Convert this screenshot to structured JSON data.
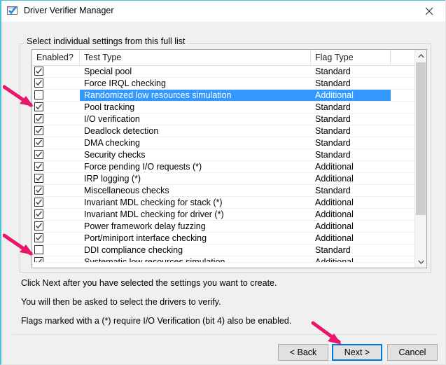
{
  "window": {
    "title": "Driver Verifier Manager",
    "icon": "driver-verifier-icon",
    "close_label": "✕",
    "accent_color": "#4cc2d6"
  },
  "groupbox": {
    "label": "Select individual settings from this full list"
  },
  "listview": {
    "columns": [
      "Enabled?",
      "Test Type",
      "Flag Type",
      ""
    ],
    "selection_color": "#3399ff",
    "rows": [
      {
        "enabled": true,
        "test": "Special pool",
        "flag": "Standard",
        "selected": false
      },
      {
        "enabled": true,
        "test": "Force IRQL checking",
        "flag": "Standard",
        "selected": false
      },
      {
        "enabled": false,
        "test": "Randomized low resources simulation",
        "flag": "Additional",
        "selected": true
      },
      {
        "enabled": true,
        "test": "Pool tracking",
        "flag": "Standard",
        "selected": false
      },
      {
        "enabled": true,
        "test": "I/O verification",
        "flag": "Standard",
        "selected": false
      },
      {
        "enabled": true,
        "test": "Deadlock detection",
        "flag": "Standard",
        "selected": false
      },
      {
        "enabled": true,
        "test": "DMA checking",
        "flag": "Standard",
        "selected": false
      },
      {
        "enabled": true,
        "test": "Security checks",
        "flag": "Standard",
        "selected": false
      },
      {
        "enabled": true,
        "test": "Force pending I/O requests (*)",
        "flag": "Additional",
        "selected": false
      },
      {
        "enabled": true,
        "test": "IRP logging (*)",
        "flag": "Additional",
        "selected": false
      },
      {
        "enabled": true,
        "test": "Miscellaneous checks",
        "flag": "Standard",
        "selected": false
      },
      {
        "enabled": true,
        "test": "Invariant MDL checking for stack (*)",
        "flag": "Additional",
        "selected": false
      },
      {
        "enabled": true,
        "test": "Invariant MDL checking for driver (*)",
        "flag": "Additional",
        "selected": false
      },
      {
        "enabled": true,
        "test": "Power framework delay fuzzing",
        "flag": "Additional",
        "selected": false
      },
      {
        "enabled": true,
        "test": "Port/miniport interface checking",
        "flag": "Additional",
        "selected": false
      },
      {
        "enabled": false,
        "test": "DDI compliance checking",
        "flag": "Standard",
        "selected": false
      },
      {
        "enabled": true,
        "test": "Systematic low resources simulation",
        "flag": "Additional",
        "selected": false
      }
    ]
  },
  "scrollbar": {
    "up_arrow": "chevron-up",
    "down_arrow": "chevron-down"
  },
  "instructions": {
    "line1": "Click Next after you have selected the settings you want to create.",
    "line2": "You will then be asked to select the drivers to verify.",
    "line3": "Flags marked with a (*) require I/O Verification (bit 4) also be enabled."
  },
  "footer": {
    "back_label": "< Back",
    "next_label": "Next >",
    "cancel_label": "Cancel"
  },
  "annotations": {
    "color": "#e8176b",
    "count": 3
  }
}
